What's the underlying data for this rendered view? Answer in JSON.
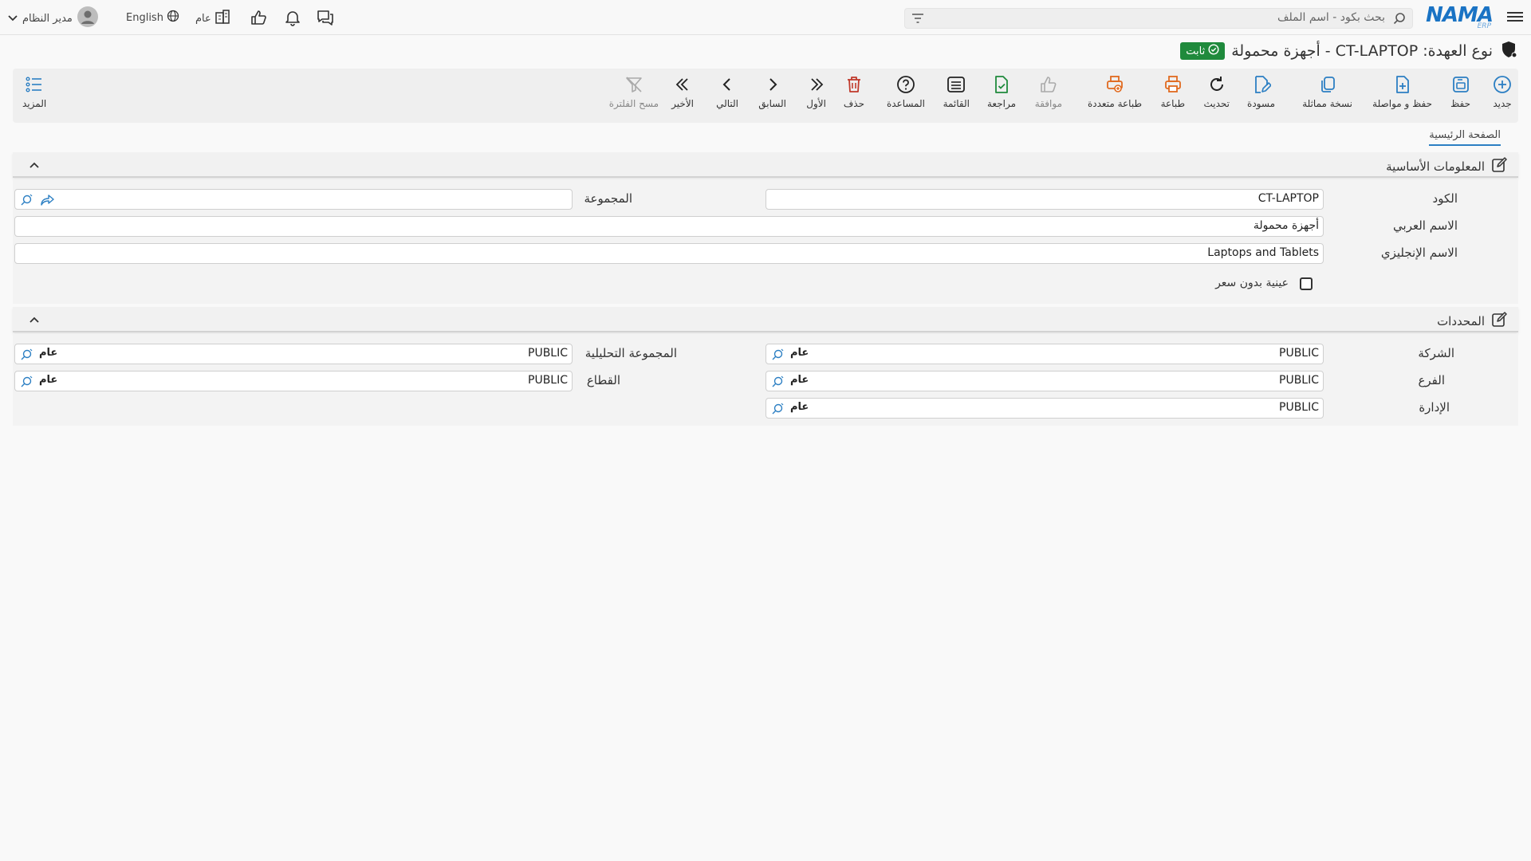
{
  "topbar": {
    "logo_text": "NAMA",
    "logo_sub": "ERP",
    "search_placeholder": "بحث بكود - اسم الملف",
    "language_label": "English",
    "general_label": "عام",
    "user_name": "مدير النظام"
  },
  "page": {
    "title": "نوع العهدة: CT-LAPTOP - أجهزة محمولة",
    "status_badge": "ثابت",
    "status_color": "#1f8a3c"
  },
  "toolbar": {
    "new": "جديد",
    "save": "حفظ",
    "save_continue": "حفظ و مواصلة",
    "duplicate": "نسخة مماثلة",
    "draft": "مسودة",
    "refresh": "تحديث",
    "print": "طباعة",
    "multi_print": "طباعة متعددة",
    "approve": "موافقة",
    "review": "مراجعة",
    "list": "القائمة",
    "help": "المساعدة",
    "delete": "حذف",
    "first": "الأول",
    "previous": "السابق",
    "next": "التالي",
    "last": "الأخير",
    "clear_filter": "مسح الفلترة",
    "more": "المزيد"
  },
  "tabs": {
    "main": "الصفحة الرئيسية"
  },
  "basic_info": {
    "title": "المعلومات الأساسية",
    "code_label": "الكود",
    "code_value": "CT-LAPTOP",
    "group_label": "المجموعة",
    "group_value": "",
    "arabic_name_label": "الاسم العربي",
    "arabic_name_value": "أجهزة محمولة",
    "english_name_label": "الاسم الإنجليزي",
    "english_name_value": "Laptops and Tablets",
    "sample_label": "عينية بدون سعر",
    "sample_checked": false
  },
  "dimensions": {
    "title": "المحددات",
    "company_label": "الشركة",
    "company_value": "PUBLIC",
    "company_tag": "عام",
    "analytic_group_label": "المجموعة التحليلية",
    "analytic_group_value": "PUBLIC",
    "analytic_group_tag": "عام",
    "branch_label": "الفرع",
    "branch_value": "PUBLIC",
    "branch_tag": "عام",
    "sector_label": "القطاع",
    "sector_value": "PUBLIC",
    "sector_tag": "عام",
    "department_label": "الإدارة",
    "department_value": "PUBLIC",
    "department_tag": "عام"
  }
}
